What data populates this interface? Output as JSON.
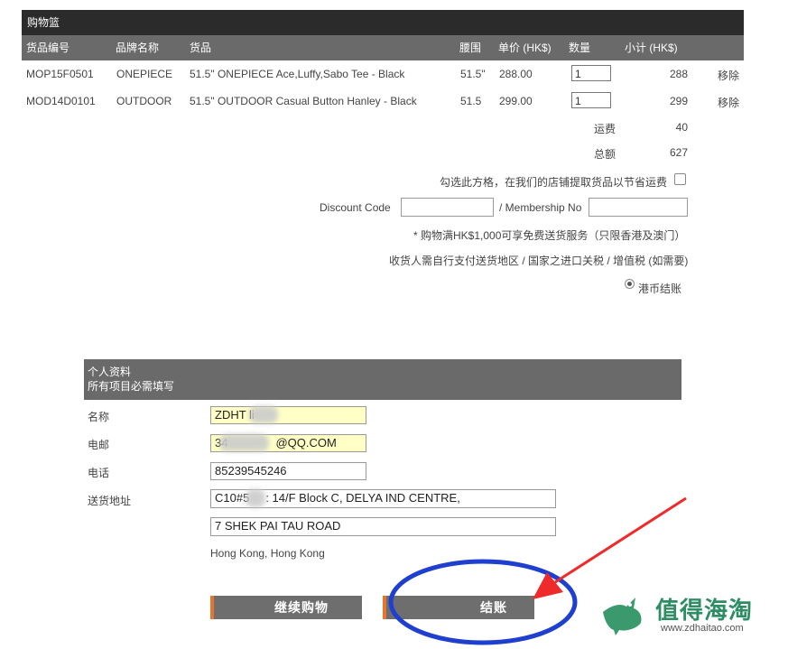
{
  "cart": {
    "title": "购物篮",
    "headers": {
      "code": "货品编号",
      "brand": "品牌名称",
      "item": "货品",
      "waist": "腰围",
      "unit_price": "单价 (HK$)",
      "qty": "数量",
      "subtotal": "小计 (HK$)"
    },
    "rows": [
      {
        "code": "MOP15F0501",
        "brand": "ONEPIECE",
        "item": "51.5\" ONEPIECE Ace,Luffy,Sabo Tee - Black",
        "waist": "51.5\"",
        "price": "288.00",
        "qty": "1",
        "subtotal": "288",
        "remove": "移除"
      },
      {
        "code": "MOD14D0101",
        "brand": "OUTDOOR",
        "item": "51.5\" OUTDOOR Casual Button Hanley - Black",
        "waist": "51.5",
        "price": "299.00",
        "qty": "1",
        "subtotal": "299",
        "remove": "移除"
      }
    ],
    "shipping_label": "运费",
    "shipping_value": "40",
    "total_label": "总额",
    "total_value": "627",
    "pickup_text": "勾选此方格，在我们的店铺提取货品以节省运费",
    "discount_label": "Discount Code",
    "membership_label": "/  Membership No",
    "free_shipping_note": "* 购物满HK$1,000可享免费送货服务（只限香港及澳门）",
    "duty_note": "收货人需自行支付送货地区 / 国家之进口关税 / 增值税 (如需要)",
    "currency_option": "港币结账"
  },
  "personal": {
    "title": "个人资料",
    "subtitle": "所有项目必需填写",
    "name_label": "名称",
    "name_value": "ZDHT li",
    "email_label": "电邮",
    "email_value_prefix": "34",
    "email_value_suffix": "@QQ.COM",
    "phone_label": "电话",
    "phone_value": "85239545246",
    "address_label": "送货地址",
    "address_line1_prefix": "C10#5",
    "address_line1_suffix": ": 14/F Block C, DELYA IND CENTRE,",
    "address_line2": "7 SHEK PAI TAU ROAD",
    "address_region": "Hong Kong, Hong Kong"
  },
  "buttons": {
    "continue_label": "继续购物",
    "checkout_label": "结账"
  },
  "watermark": {
    "brand": "值得海淘",
    "url": "www.zdhaitao.com"
  },
  "colors": {
    "accent": "#e8752e",
    "annotation_blue": "#1f3fcf",
    "annotation_red": "#ee2a2a",
    "logo_green": "#3a9a6e"
  }
}
